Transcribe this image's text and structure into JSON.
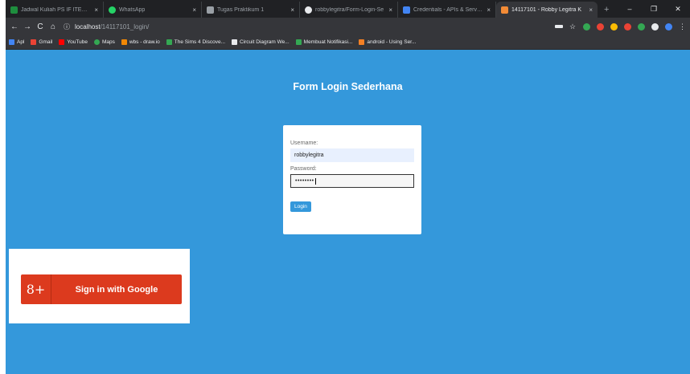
{
  "tabs": [
    {
      "title": "Jadwal Kuliah PS IF ITERA Ge",
      "fav_color": "#1e8e3e",
      "close": "×"
    },
    {
      "title": "WhatsApp",
      "fav_color": "#25d366",
      "close": "×"
    },
    {
      "title": "Tugas Praktikum 1",
      "fav_color": "#9aa0a6",
      "close": "×"
    },
    {
      "title": "robbylegitra/Form-Login-Se",
      "fav_color": "#e8eaed",
      "close": "×"
    },
    {
      "title": "Credentials - APIs & Service",
      "fav_color": "#4285f4",
      "close": "×"
    },
    {
      "title": "14117101 - Robby Legitra K",
      "fav_color": "#f28b36",
      "close": "×"
    }
  ],
  "new_tab": "+",
  "window_controls": {
    "minimize": "–",
    "maximize": "❐",
    "close": "✕"
  },
  "toolbar": {
    "back": "←",
    "forward": "→",
    "reload": "C",
    "home": "⌂",
    "info_icon": "ⓘ",
    "url_host": "localhost",
    "url_path": "/14117101_login/"
  },
  "extension_colors": [
    "#e8eaed",
    "#f6c026",
    "#34a853",
    "#ea4335",
    "#fbbc04",
    "#ea4335",
    "#34a853",
    "#e8eaed",
    "#4285f4"
  ],
  "bookmarks": [
    {
      "label": "Apl",
      "color": "#4285f4"
    },
    {
      "label": "Gmail",
      "color": "#ea4335"
    },
    {
      "label": "YouTube",
      "color": "#ff0000"
    },
    {
      "label": "Maps",
      "color": "#34a853"
    },
    {
      "label": "wbs - draw.io",
      "color": "#f08705"
    },
    {
      "label": "The Sims 4 Discove...",
      "color": "#34a853"
    },
    {
      "label": "Circuit Diagram We...",
      "color": "#e8eaed"
    },
    {
      "label": "Membuat Notifikasi...",
      "color": "#34a853"
    },
    {
      "label": "android - Using Ser...",
      "color": "#f48024"
    }
  ],
  "page": {
    "title": "Form Login Sederhana",
    "background": "#3498db",
    "username_label": "Username:",
    "username_value": "robbylegitra",
    "password_label": "Password:",
    "password_value": "••••••••",
    "login_label": "Login"
  },
  "google": {
    "icon_text": "8+",
    "label": "Sign in with Google",
    "color": "#dc3a1e"
  }
}
